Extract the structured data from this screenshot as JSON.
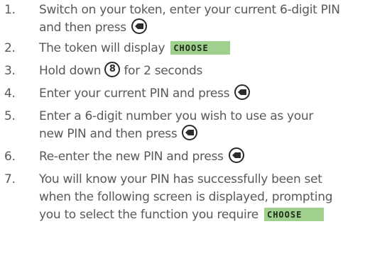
{
  "steps": [
    {
      "number": "1.",
      "lines": [
        "Switch on your token, enter your current 6-digit PIN",
        "and then press"
      ]
    },
    {
      "number": "2.",
      "lines": [
        "The token will display"
      ]
    },
    {
      "number": "3.",
      "lines": [
        "Hold down",
        "for 2 seconds"
      ]
    },
    {
      "number": "4.",
      "lines": [
        "Enter your current PIN and press"
      ]
    },
    {
      "number": "5.",
      "lines": [
        "Enter a 6-digit number you wish to use as your",
        "new PIN and then press"
      ]
    },
    {
      "number": "6.",
      "lines": [
        "Re-enter the new PIN and press"
      ]
    },
    {
      "number": "7.",
      "lines": [
        "You will know your PIN has successfully been set",
        "when the following screen is displayed, prompting",
        "you to select the function you require"
      ]
    }
  ],
  "token": {
    "display_text": "CHOOSE",
    "digit_key": "8",
    "lcd_color": "#9fd08e",
    "text_color": "#58595b",
    "key_icon": "enter-key-icon"
  }
}
